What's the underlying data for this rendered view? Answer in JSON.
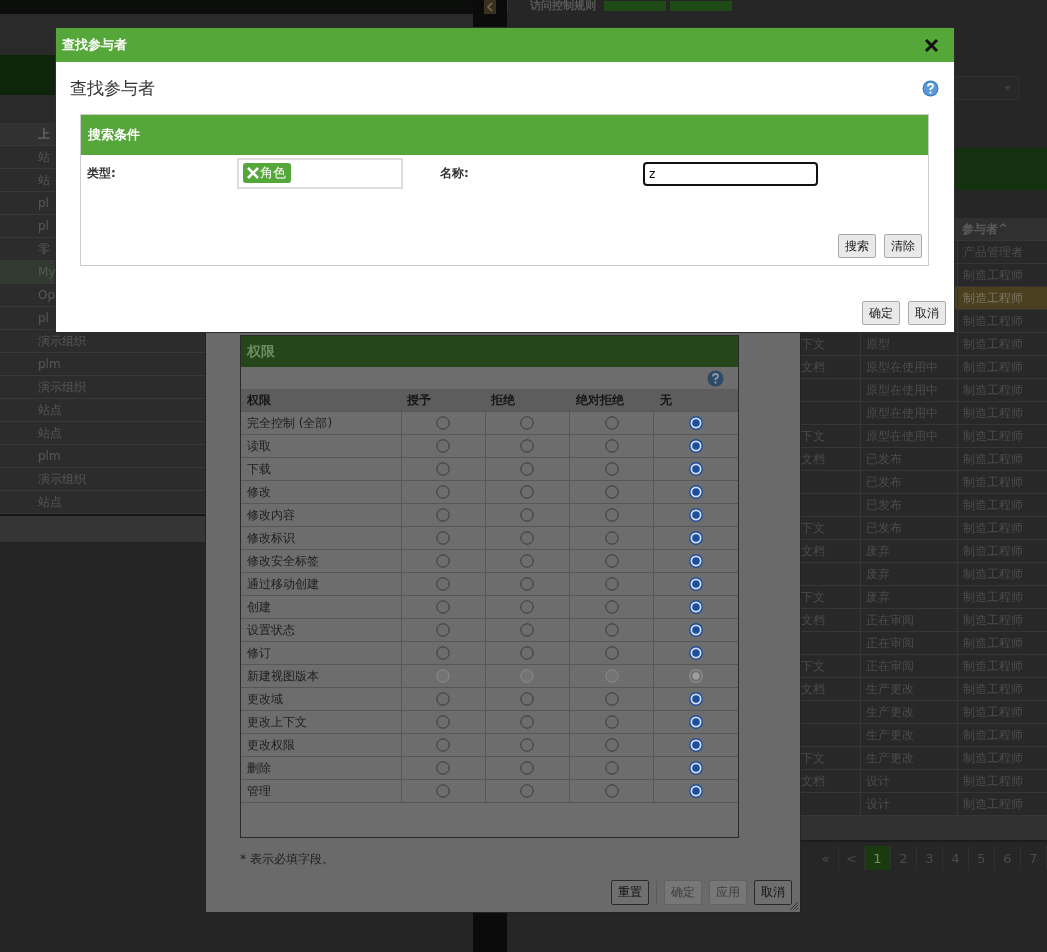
{
  "left_panel": {
    "table": {
      "column_header": "上",
      "rows": [
        {
          "text": "站",
          "selected": false
        },
        {
          "text": "站",
          "selected": false
        },
        {
          "text": "pl",
          "selected": false
        },
        {
          "text": "pl",
          "selected": false
        },
        {
          "text": "零",
          "selected": false
        },
        {
          "text": "My",
          "selected": true
        },
        {
          "text": "Op",
          "selected": false
        },
        {
          "text": "pl",
          "selected": false
        },
        {
          "text": "演示组织",
          "selected": false
        },
        {
          "text": "plm",
          "selected": false
        },
        {
          "text": "演示组织",
          "selected": false
        },
        {
          "text": "站点",
          "selected": false
        },
        {
          "text": "站点",
          "selected": false
        },
        {
          "text": "plm",
          "selected": false
        },
        {
          "text": "演示组织",
          "selected": false
        },
        {
          "text": "站点",
          "selected": false
        }
      ]
    }
  },
  "right_panel": {
    "title": "访问控制规则",
    "table": {
      "column_header": "参与者^",
      "rows": [
        {
          "participant": "产品管理者",
          "selected": false
        },
        {
          "participant": "制造工程师",
          "selected": false
        },
        {
          "participant": "制造工程师",
          "selected": true
        },
        {
          "participant": "制造工程师",
          "selected": false
        },
        {
          "context": "下文",
          "state": "原型",
          "participant": "制造工程师",
          "selected": false
        },
        {
          "context": "文档",
          "state": "原型在使用中",
          "participant": "制造工程师",
          "selected": false
        },
        {
          "state": "原型在使用中",
          "participant": "制造工程师",
          "selected": false
        },
        {
          "state": "原型在使用中",
          "participant": "制造工程师",
          "selected": false
        },
        {
          "context": "下文",
          "state": "原型在使用中",
          "participant": "制造工程师",
          "selected": false
        },
        {
          "context": "文档",
          "state": "已发布",
          "participant": "制造工程师",
          "selected": false
        },
        {
          "state": "已发布",
          "participant": "制造工程师",
          "selected": false
        },
        {
          "state": "已发布",
          "participant": "制造工程师",
          "selected": false
        },
        {
          "context": "下文",
          "state": "已发布",
          "participant": "制造工程师",
          "selected": false
        },
        {
          "context": "文档",
          "state": "废弃",
          "participant": "制造工程师",
          "selected": false
        },
        {
          "state": "废弃",
          "participant": "制造工程师",
          "selected": false
        },
        {
          "context": "下文",
          "state": "废弃",
          "participant": "制造工程师",
          "selected": false
        },
        {
          "context": "文档",
          "state": "正在审阅",
          "participant": "制造工程师",
          "selected": false
        },
        {
          "state": "正在审阅",
          "participant": "制造工程师",
          "selected": false
        },
        {
          "context": "下文",
          "state": "正在审阅",
          "participant": "制造工程师",
          "selected": false
        },
        {
          "context": "文档",
          "state": "生产更改",
          "participant": "制造工程师",
          "selected": false
        },
        {
          "state": "生产更改",
          "participant": "制造工程师",
          "selected": false
        },
        {
          "state": "生产更改",
          "participant": "制造工程师",
          "selected": false
        },
        {
          "context": "下文",
          "state": "生产更改",
          "participant": "制造工程师",
          "selected": false
        },
        {
          "context": "文档",
          "state": "设计",
          "participant": "制造工程师",
          "selected": false
        },
        {
          "state": "设计",
          "participant": "制造工程师",
          "selected": false
        }
      ]
    },
    "pagination": {
      "first": "«",
      "prev": "<",
      "pages": [
        {
          "label": "1",
          "selected": true
        },
        {
          "label": "2",
          "selected": false
        },
        {
          "label": "3",
          "selected": false
        },
        {
          "label": "4",
          "selected": false
        },
        {
          "label": "5",
          "selected": false
        },
        {
          "label": "6",
          "selected": false
        },
        {
          "label": "7",
          "selected": false
        }
      ]
    }
  },
  "permissions_dialog": {
    "section_title": "权限",
    "columns": [
      "权限",
      "授予",
      "拒绝",
      "绝对拒绝",
      "无"
    ],
    "rows": [
      {
        "label": "完全控制 (全部)",
        "disabled": false,
        "radios": [
          {
            "selected": false
          },
          {
            "selected": false
          },
          {
            "selected": false
          },
          {
            "selected": true
          }
        ]
      },
      {
        "label": "读取",
        "disabled": false,
        "radios": [
          {
            "selected": false
          },
          {
            "selected": false
          },
          {
            "selected": false
          },
          {
            "selected": true
          }
        ]
      },
      {
        "label": "下载",
        "disabled": false,
        "radios": [
          {
            "selected": false
          },
          {
            "selected": false
          },
          {
            "selected": false
          },
          {
            "selected": true
          }
        ]
      },
      {
        "label": "修改",
        "disabled": false,
        "radios": [
          {
            "selected": false
          },
          {
            "selected": false
          },
          {
            "selected": false
          },
          {
            "selected": true
          }
        ]
      },
      {
        "label": "修改内容",
        "disabled": false,
        "radios": [
          {
            "selected": false
          },
          {
            "selected": false
          },
          {
            "selected": false
          },
          {
            "selected": true
          }
        ]
      },
      {
        "label": "修改标识",
        "disabled": false,
        "radios": [
          {
            "selected": false
          },
          {
            "selected": false
          },
          {
            "selected": false
          },
          {
            "selected": true
          }
        ]
      },
      {
        "label": "修改安全标签",
        "disabled": false,
        "radios": [
          {
            "selected": false
          },
          {
            "selected": false
          },
          {
            "selected": false
          },
          {
            "selected": true
          }
        ]
      },
      {
        "label": "通过移动创建",
        "disabled": false,
        "radios": [
          {
            "selected": false
          },
          {
            "selected": false
          },
          {
            "selected": false
          },
          {
            "selected": true
          }
        ]
      },
      {
        "label": "创建",
        "disabled": false,
        "radios": [
          {
            "selected": false
          },
          {
            "selected": false
          },
          {
            "selected": false
          },
          {
            "selected": true
          }
        ]
      },
      {
        "label": "设置状态",
        "disabled": false,
        "radios": [
          {
            "selected": false
          },
          {
            "selected": false
          },
          {
            "selected": false
          },
          {
            "selected": true
          }
        ]
      },
      {
        "label": "修订",
        "disabled": false,
        "radios": [
          {
            "selected": false
          },
          {
            "selected": false
          },
          {
            "selected": false
          },
          {
            "selected": true
          }
        ]
      },
      {
        "label": "新建视图版本",
        "disabled": true,
        "radios": [
          {
            "selected": false
          },
          {
            "selected": false
          },
          {
            "selected": false
          },
          {
            "selected": true
          }
        ]
      },
      {
        "label": "更改域",
        "disabled": false,
        "radios": [
          {
            "selected": false
          },
          {
            "selected": false
          },
          {
            "selected": false
          },
          {
            "selected": true
          }
        ]
      },
      {
        "label": "更改上下文",
        "disabled": false,
        "radios": [
          {
            "selected": false
          },
          {
            "selected": false
          },
          {
            "selected": false
          },
          {
            "selected": true
          }
        ]
      },
      {
        "label": "更改权限",
        "disabled": false,
        "radios": [
          {
            "selected": false
          },
          {
            "selected": false
          },
          {
            "selected": false
          },
          {
            "selected": true
          }
        ]
      },
      {
        "label": "删除",
        "disabled": false,
        "radios": [
          {
            "selected": false
          },
          {
            "selected": false
          },
          {
            "selected": false
          },
          {
            "selected": true
          }
        ]
      },
      {
        "label": "管理",
        "disabled": false,
        "radios": [
          {
            "selected": false
          },
          {
            "selected": false
          },
          {
            "selected": false
          },
          {
            "selected": true
          }
        ]
      }
    ],
    "note": "* 表示必填字段。",
    "buttons": [
      {
        "label": "重置",
        "disabled": false
      },
      {
        "label": "确定",
        "disabled": true
      },
      {
        "label": "应用",
        "disabled": true
      },
      {
        "label": "取消",
        "disabled": false
      }
    ]
  },
  "find_dialog": {
    "title": "查找参与者",
    "heading": "查找参与者",
    "criteria": {
      "title": "搜索条件",
      "type_label": "类型:",
      "type_tags": [
        "角色"
      ],
      "name_label": "名称:",
      "name_value": "z",
      "buttons": [
        "搜索",
        "清除"
      ]
    },
    "buttons": [
      "确定",
      "取消"
    ]
  }
}
